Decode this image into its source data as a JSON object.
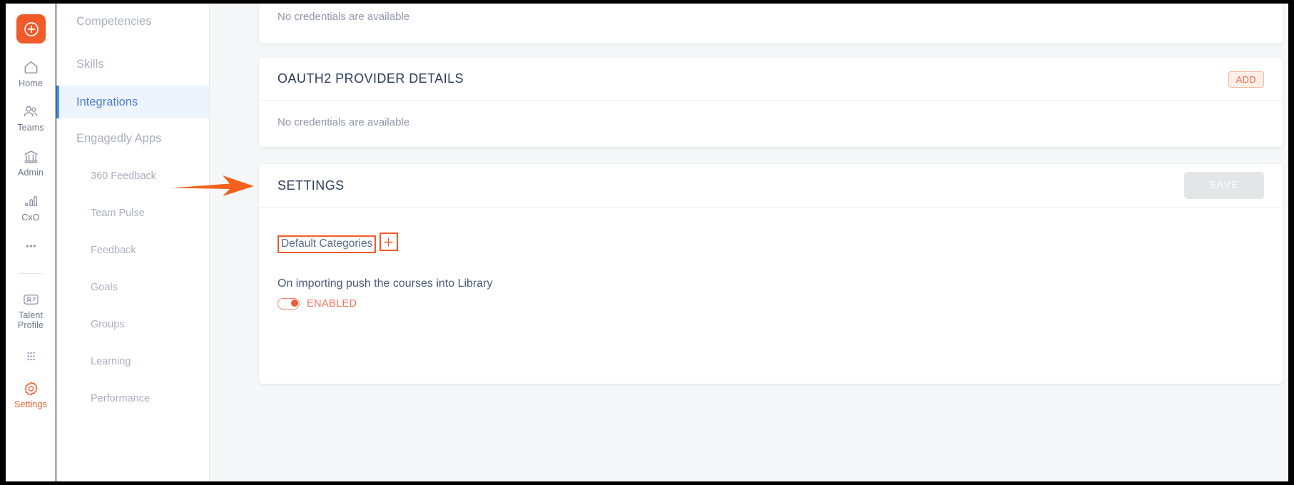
{
  "theme": {
    "accent_orange": "#f15a29",
    "accent_blue": "#4a90e2",
    "page_background": "#f6f7f8",
    "card_background": "#ffffff",
    "title_color": "#2c3a5c",
    "muted_text": "#a9b0bd"
  },
  "icon_rail": {
    "logo_icon": "circle-plus-icon",
    "items": [
      {
        "label": "Home",
        "icon": "home-icon",
        "active": false
      },
      {
        "label": "Teams",
        "icon": "people-icon",
        "active": false
      },
      {
        "label": "Admin",
        "icon": "bank-icon",
        "active": false
      },
      {
        "label": "CxO",
        "icon": "bar-chart-icon",
        "active": false
      },
      {
        "label": "",
        "icon": "more-dots-icon",
        "active": false
      },
      {
        "label": "Talent Profile",
        "icon": "id-card-icon",
        "active": false
      },
      {
        "label": "",
        "icon": "grid-dots-icon",
        "active": false
      },
      {
        "label": "Settings",
        "icon": "gear-icon",
        "active": true
      }
    ]
  },
  "secondary_nav": {
    "items": [
      {
        "label": "Competencies",
        "level": "top",
        "active": false
      },
      {
        "label": "Skills",
        "level": "top",
        "active": false
      },
      {
        "label": "Integrations",
        "level": "top",
        "active": true
      },
      {
        "label": "Engagedly Apps",
        "level": "top",
        "active": false
      },
      {
        "label": "360 Feedback",
        "level": "sub",
        "active": false
      },
      {
        "label": "Team Pulse",
        "level": "sub",
        "active": false
      },
      {
        "label": "Feedback",
        "level": "sub",
        "active": false
      },
      {
        "label": "Goals",
        "level": "sub",
        "active": false
      },
      {
        "label": "Groups",
        "level": "sub",
        "active": false
      },
      {
        "label": "Learning",
        "level": "sub",
        "active": false
      },
      {
        "label": "Performance",
        "level": "sub",
        "active": false
      }
    ]
  },
  "main": {
    "credentials_card": {
      "empty_text": "No credentials are available"
    },
    "oauth2_card": {
      "title": "OAUTH2 PROVIDER DETAILS",
      "add_label": "ADD",
      "empty_text": "No credentials are available"
    },
    "settings_card": {
      "title": "SETTINGS",
      "save_label": "SAVE",
      "save_disabled": true,
      "default_categories_label": "Default Categories",
      "add_category_icon": "plus-icon",
      "import_setting_text": "On importing push the courses into Library",
      "toggle_state_label": "ENABLED",
      "toggle_enabled": true
    }
  },
  "annotations": {
    "arrow_target": "SETTINGS",
    "highlight_boxes": [
      "Default Categories",
      "plus-icon"
    ]
  }
}
